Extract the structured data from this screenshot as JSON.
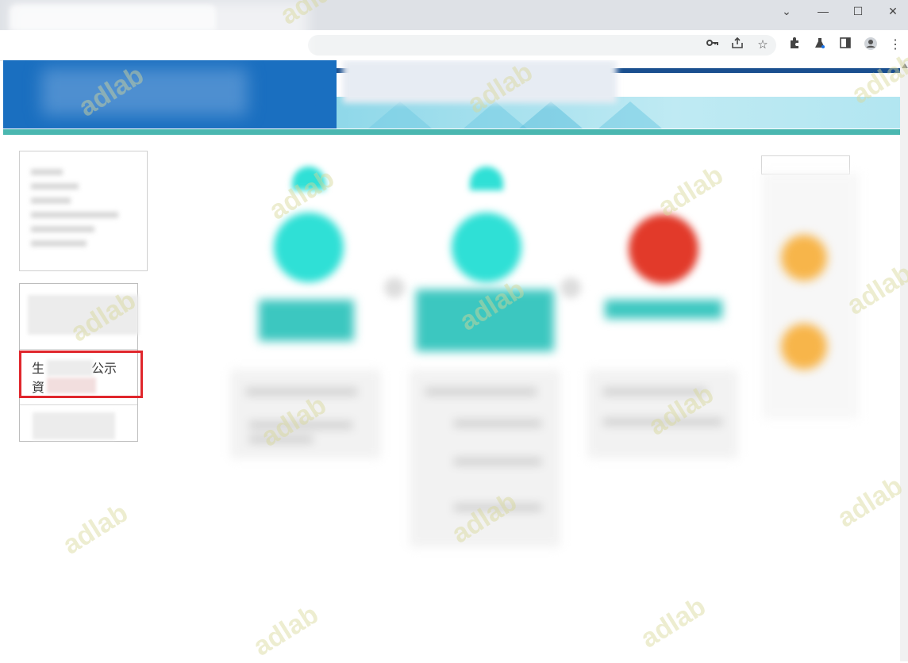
{
  "browser": {
    "window_controls": {
      "minimize": "—",
      "maximize": "☐",
      "close": "✕",
      "tab_list": "⌄"
    },
    "toolbar_icons": [
      "key-icon",
      "share-icon",
      "star-icon",
      "extensions-icon",
      "labs-icon",
      "sidepanel-icon",
      "profile-icon",
      "menu-icon"
    ]
  },
  "sidebar": {
    "menu_items": [
      {
        "label": ""
      },
      {
        "label_line1_start": "生",
        "label_line1_end": "公示",
        "label_line2_start": "資"
      },
      {
        "label": ""
      }
    ],
    "highlight_color": "#e0262c"
  },
  "steps": {
    "colors": {
      "teal": "#2fe0d6",
      "red": "#e23a2a",
      "orange": "#f7b54a",
      "header_blue": "#1a6fc0",
      "teal_rule": "#4ab7b0"
    }
  },
  "watermark": {
    "text": "adlab"
  }
}
